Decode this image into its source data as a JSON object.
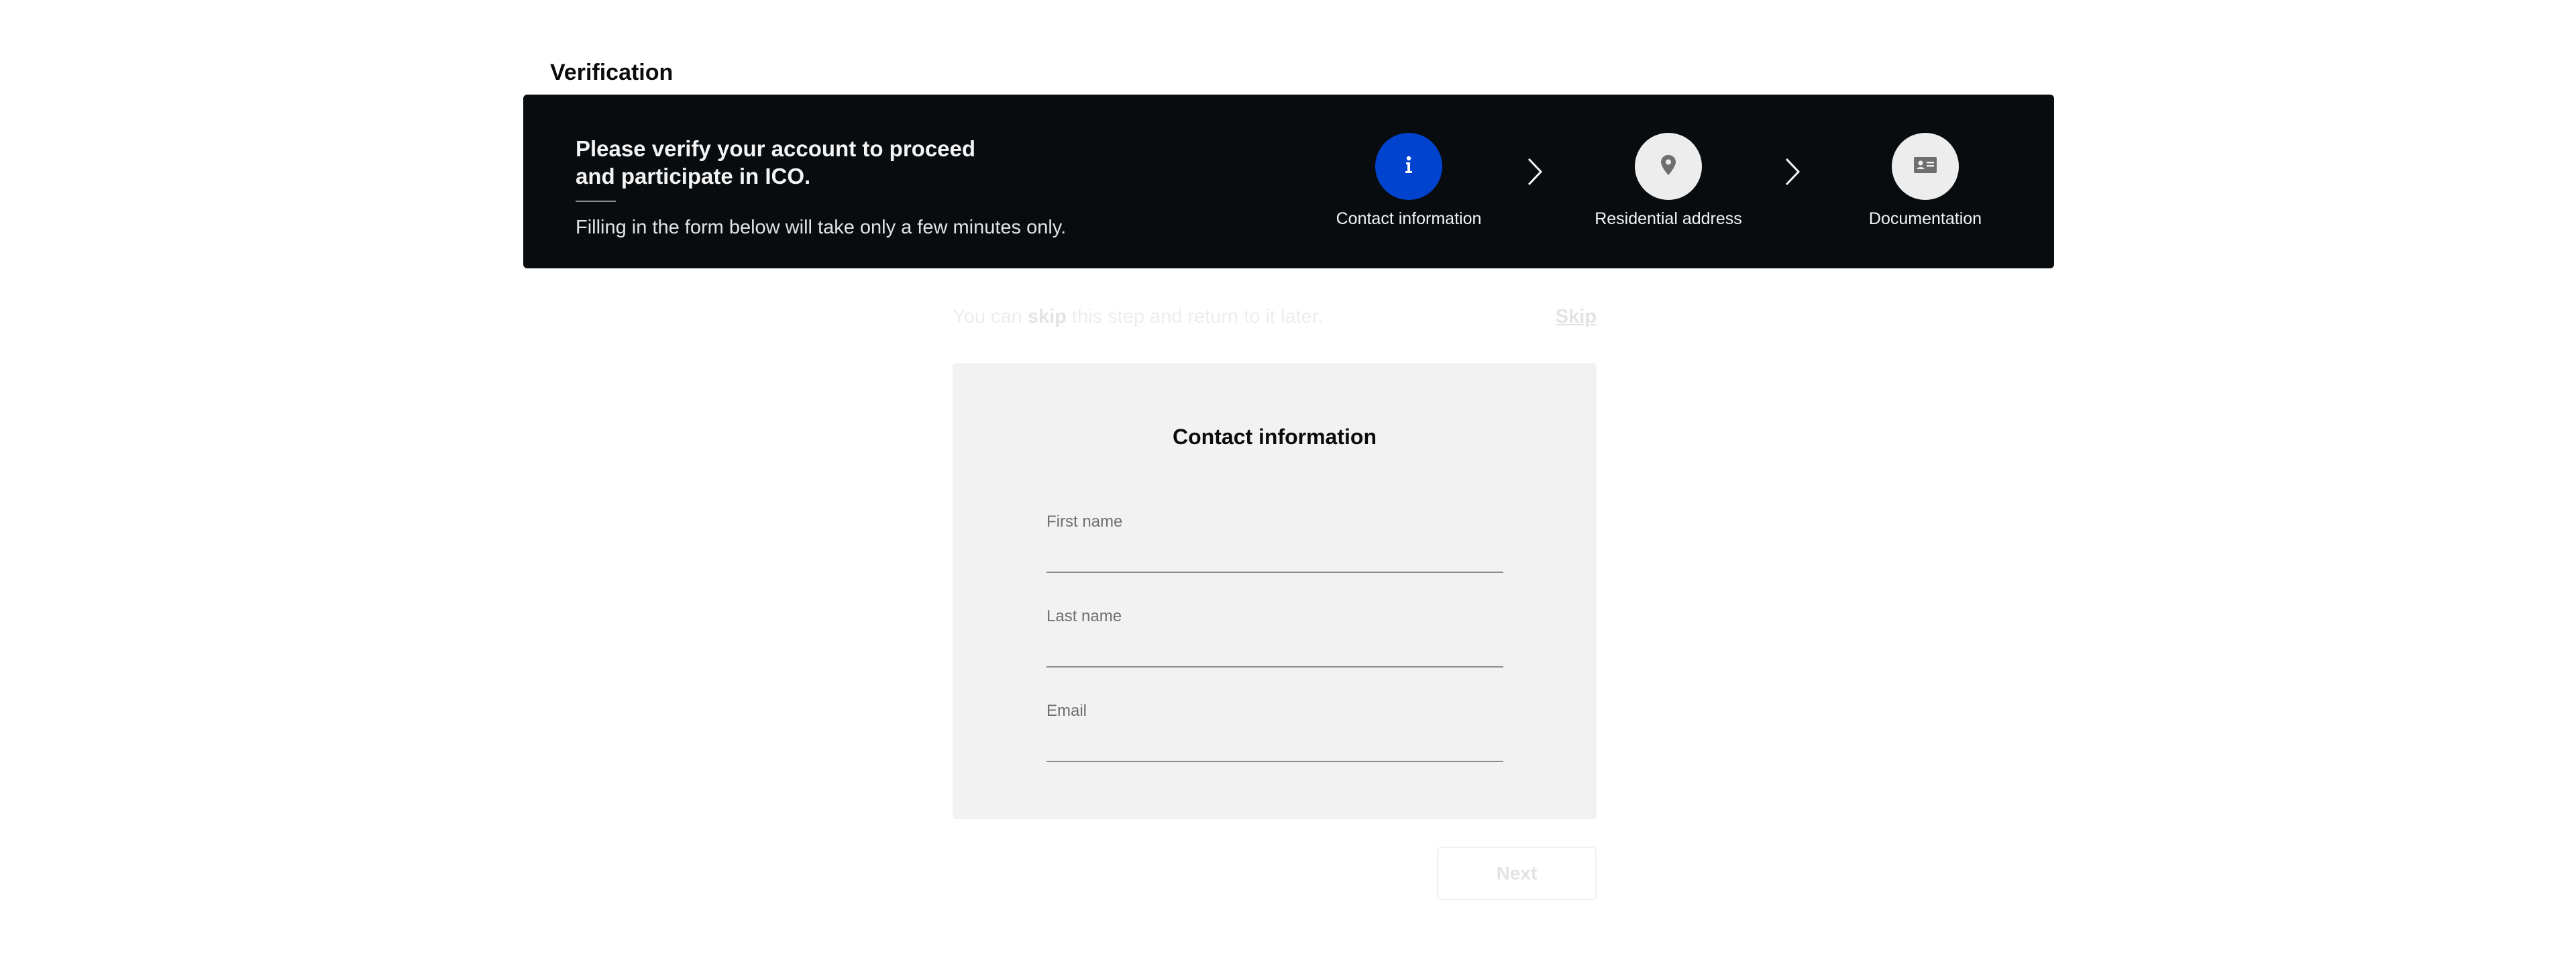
{
  "page": {
    "title": "Verification"
  },
  "banner": {
    "heading": "Please verify your account to proceed and participate in ICO.",
    "subtitle": "Filling in the form below will take only a few minutes only."
  },
  "steps": [
    {
      "label": "Contact information",
      "icon": "info-icon",
      "active": true
    },
    {
      "label": "Residential address",
      "icon": "location-pin-icon",
      "active": false
    },
    {
      "label": "Documentation",
      "icon": "id-card-icon",
      "active": false
    }
  ],
  "skip": {
    "prefix": "You can ",
    "bold": "skip",
    "suffix": " this step and return to it later.",
    "link_label": "Skip"
  },
  "form": {
    "title": "Contact information",
    "fields": [
      {
        "label": "First name",
        "value": ""
      },
      {
        "label": "Last name",
        "value": ""
      },
      {
        "label": "Email",
        "value": ""
      }
    ]
  },
  "actions": {
    "next_label": "Next"
  },
  "colors": {
    "banner_bg": "#090c0f",
    "active_step": "#0043ce",
    "inactive_step": "#ededed",
    "card_bg": "#f2f2f2"
  }
}
